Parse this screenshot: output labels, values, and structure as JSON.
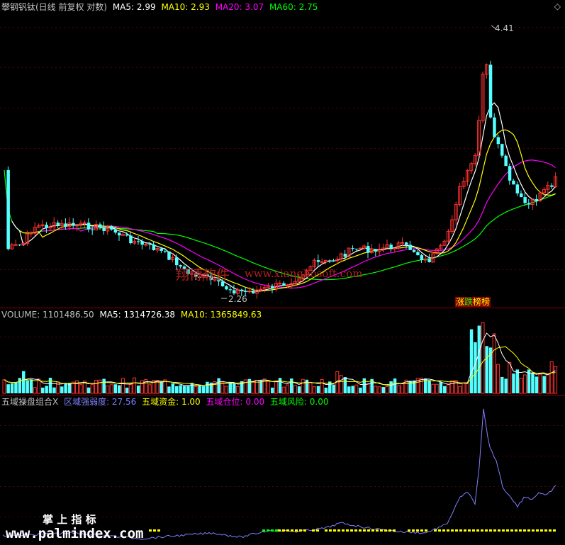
{
  "colors": {
    "bg": "#000000",
    "up": "#ff3232",
    "down": "#54ffff",
    "ma5": "#ffffff",
    "ma10": "#ffff00",
    "ma20": "#ff00ff",
    "ma60": "#00ff00",
    "grid": "#5a0000",
    "weak": "#8080ff",
    "green": "#00ff00",
    "yellow": "#ffff00"
  },
  "main": {
    "title": "攀钢钒钛(日线 前复权 对数)",
    "ma5_label": "MA5: 2.99",
    "ma10_label": "MA10: 2.93",
    "ma20_label": "MA20: 3.07",
    "ma60_label": "MA60: 2.75",
    "high_label": "4.41",
    "low_label": "2.26",
    "badge_up": "涨",
    "badge_down": "跌",
    "badge_rest": "榜榜",
    "corner_icon": "diamond-icon"
  },
  "volume": {
    "volume_label": "VOLUME: 1101486.50",
    "ma5_label": "MA5: 1314726.38",
    "ma10_label": "MA10: 1365849.63"
  },
  "indicator": {
    "name": "五域操盘组合X",
    "strength_label": "区域强弱度: 27.56",
    "fund_label": "五域资金: 1.00",
    "position_label": "五域仓位: 0.00",
    "risk_label": "五域风险: 0.00"
  },
  "watermarks": {
    "cn": "翔博软件",
    "url": "www.xiangbosoft.com",
    "bottom_cn": "掌 上 指 标",
    "bottom_url": "www.palmindex.com"
  }
}
